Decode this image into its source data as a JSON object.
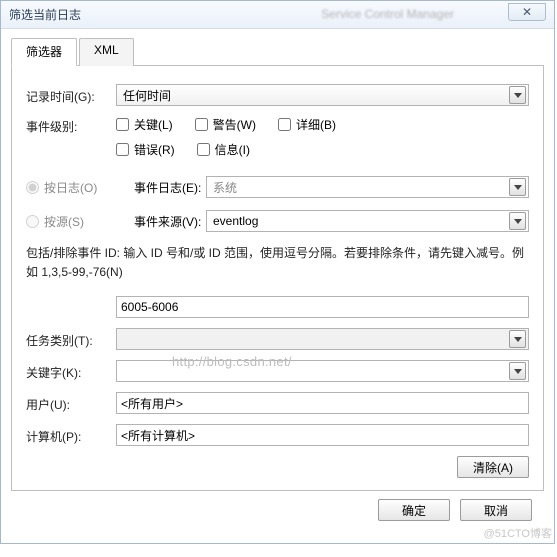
{
  "window": {
    "title": "筛选当前日志",
    "ghost_app": "Service Control Manager",
    "close_icon": "✕"
  },
  "tabs": {
    "filter": "筛选器",
    "xml": "XML"
  },
  "labels": {
    "log_time": "记录时间(G):",
    "event_level": "事件级别:",
    "by_log": "按日志(O)",
    "by_source": "按源(S)",
    "event_log": "事件日志(E):",
    "event_source": "事件来源(V):",
    "task_category": "任务类别(T):",
    "keywords": "关键字(K):",
    "user": "用户(U):",
    "computer": "计算机(P):"
  },
  "values": {
    "log_time": "任何时间",
    "event_log": "系统",
    "event_source": "eventlog",
    "id_input": "6005-6006",
    "task_category": "",
    "keywords": "",
    "user": "<所有用户>",
    "computer": "<所有计算机>"
  },
  "checkboxes": {
    "critical": "关键(L)",
    "warning": "警告(W)",
    "verbose": "详细(B)",
    "error": "错误(R)",
    "info": "信息(I)"
  },
  "help_text": "包括/排除事件 ID: 输入 ID 号和/或 ID 范围，使用逗号分隔。若要排除条件，请先键入减号。例如 1,3,5-99,-76(N)",
  "buttons": {
    "clear": "清除(A)",
    "ok": "确定",
    "cancel": "取消"
  },
  "watermark": "http://blog.csdn.net/",
  "corner_tag": "@51CTO博客"
}
